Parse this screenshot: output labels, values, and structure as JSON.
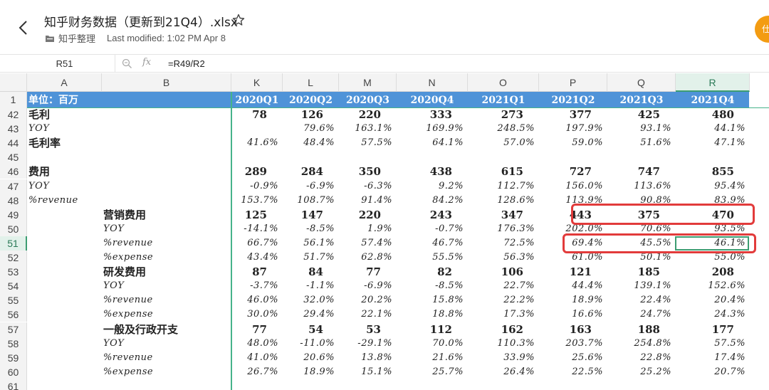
{
  "file": {
    "title": "知乎财务数据（更新到21Q4）.xlsx",
    "owner": "知乎整理",
    "modified": "Last modified: 1:02 PM Apr 8",
    "avatar_text": "仕"
  },
  "formula_bar": {
    "cell_ref": "R51",
    "fx": "fx",
    "formula": "=R49/R2"
  },
  "columns": [
    "A",
    "B",
    "K",
    "L",
    "M",
    "N",
    "O",
    "P",
    "Q",
    "R"
  ],
  "selected_column": "R",
  "header": {
    "row_num": "1",
    "unit": "单位：百万",
    "quarters": [
      "2020Q1",
      "2020Q2",
      "2020Q3",
      "2020Q4",
      "2021Q1",
      "2021Q2",
      "2021Q3",
      "2021Q4"
    ]
  },
  "selected_row": "51",
  "rows": [
    {
      "num": "42",
      "a": "毛利",
      "b": "",
      "style": "bold",
      "vals": [
        "78",
        "126",
        "220",
        "333",
        "273",
        "377",
        "425",
        "480"
      ]
    },
    {
      "num": "43",
      "a": "YOY",
      "b": "",
      "style": "ital",
      "vals": [
        "",
        "79.6%",
        "163.1%",
        "169.9%",
        "248.5%",
        "197.9%",
        "93.1%",
        "44.1%"
      ]
    },
    {
      "num": "44",
      "a": "毛利率",
      "b": "",
      "style": "ital",
      "a_bold": true,
      "vals": [
        "41.6%",
        "48.4%",
        "57.5%",
        "64.1%",
        "57.0%",
        "59.0%",
        "51.6%",
        "47.1%"
      ]
    },
    {
      "num": "45",
      "a": "",
      "b": "",
      "style": "ital",
      "vals": [
        "",
        "",
        "",
        "",
        "",
        "",
        "",
        ""
      ]
    },
    {
      "num": "46",
      "a": "费用",
      "b": "",
      "style": "bold",
      "vals": [
        "289",
        "284",
        "350",
        "438",
        "615",
        "727",
        "747",
        "855"
      ]
    },
    {
      "num": "47",
      "a": "YOY",
      "b": "",
      "style": "ital",
      "vals": [
        "-0.9%",
        "-6.9%",
        "-6.3%",
        "9.2%",
        "112.7%",
        "156.0%",
        "113.6%",
        "95.4%"
      ]
    },
    {
      "num": "48",
      "a": "%revenue",
      "b": "",
      "style": "ital",
      "vals": [
        "153.7%",
        "108.7%",
        "91.4%",
        "84.2%",
        "128.6%",
        "113.9%",
        "90.8%",
        "83.9%"
      ]
    },
    {
      "num": "49",
      "a": "",
      "b": "营销费用",
      "style": "bold",
      "vals": [
        "125",
        "147",
        "220",
        "243",
        "347",
        "443",
        "375",
        "470"
      ]
    },
    {
      "num": "50",
      "a": "",
      "b": "YOY",
      "style": "ital",
      "vals": [
        "-14.1%",
        "-8.5%",
        "1.9%",
        "-0.7%",
        "176.3%",
        "202.0%",
        "70.6%",
        "93.5%"
      ]
    },
    {
      "num": "51",
      "a": "",
      "b": "%revenue",
      "style": "ital",
      "vals": [
        "66.7%",
        "56.1%",
        "57.4%",
        "46.7%",
        "72.5%",
        "69.4%",
        "45.5%",
        "46.1%"
      ]
    },
    {
      "num": "52",
      "a": "",
      "b": "%expense",
      "style": "ital",
      "vals": [
        "43.4%",
        "51.7%",
        "62.8%",
        "55.5%",
        "56.3%",
        "61.0%",
        "50.1%",
        "55.0%"
      ]
    },
    {
      "num": "53",
      "a": "",
      "b": "研发费用",
      "style": "bold",
      "vals": [
        "87",
        "84",
        "77",
        "82",
        "106",
        "121",
        "185",
        "208"
      ]
    },
    {
      "num": "54",
      "a": "",
      "b": "YOY",
      "style": "ital",
      "vals": [
        "-3.7%",
        "-1.1%",
        "-6.9%",
        "-8.5%",
        "22.7%",
        "44.4%",
        "139.1%",
        "152.6%"
      ]
    },
    {
      "num": "55",
      "a": "",
      "b": "%revenue",
      "style": "ital",
      "vals": [
        "46.0%",
        "32.0%",
        "20.2%",
        "15.8%",
        "22.2%",
        "18.9%",
        "22.4%",
        "20.4%"
      ]
    },
    {
      "num": "56",
      "a": "",
      "b": "%expense",
      "style": "ital",
      "vals": [
        "30.0%",
        "29.4%",
        "22.1%",
        "18.8%",
        "17.3%",
        "16.6%",
        "24.7%",
        "24.3%"
      ]
    },
    {
      "num": "57",
      "a": "",
      "b": "一般及行政开支",
      "style": "bold",
      "vals": [
        "77",
        "54",
        "53",
        "112",
        "162",
        "163",
        "188",
        "177"
      ]
    },
    {
      "num": "58",
      "a": "",
      "b": "YOY",
      "style": "ital",
      "vals": [
        "48.0%",
        "-11.0%",
        "-29.1%",
        "70.0%",
        "110.3%",
        "203.7%",
        "254.8%",
        "57.5%"
      ]
    },
    {
      "num": "59",
      "a": "",
      "b": "%revenue",
      "style": "ital",
      "vals": [
        "41.0%",
        "20.6%",
        "13.8%",
        "21.6%",
        "33.9%",
        "25.6%",
        "22.8%",
        "17.4%"
      ]
    },
    {
      "num": "60",
      "a": "",
      "b": "%expense",
      "style": "ital",
      "vals": [
        "26.7%",
        "18.9%",
        "15.1%",
        "25.7%",
        "26.4%",
        "22.5%",
        "25.2%",
        "20.7%"
      ]
    },
    {
      "num": "61",
      "a": "",
      "b": "",
      "style": "ital",
      "vals": [
        "",
        "",
        "",
        "",
        "",
        "",
        "",
        ""
      ]
    }
  ],
  "colors": {
    "header_bg": "#4f93d8",
    "highlight": "#e23b3b",
    "selection": "#3c9d72",
    "avatar": "#f39c12"
  }
}
